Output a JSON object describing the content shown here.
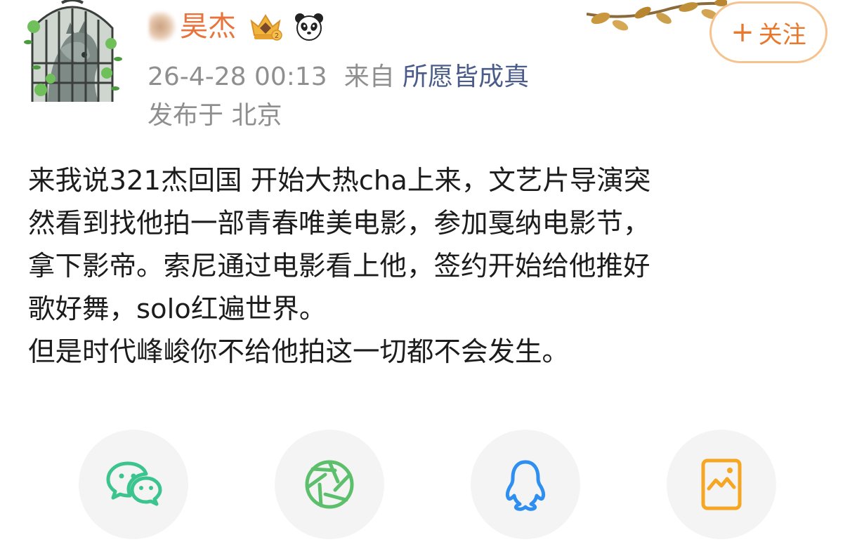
{
  "post": {
    "username": "昊杰",
    "datetime": "26-4-28 00:13",
    "source_prefix": "来自",
    "source_name": "所愿皆成真",
    "location": "发布于 北京",
    "follow_label": "关注",
    "text_lines": [
      "来我说321杰回国 开始大热cha上来，文艺片导演突",
      "然看到找他拍一部青春唯美电影，参加戛纳电影节，",
      "拿下影帝。索尼通过电影看上他，签约开始给他推好",
      "歌好舞，solo红遍世界。",
      "但是时代峰峻你不给他拍这一切都不会发生。"
    ]
  },
  "share": {
    "buttons": [
      {
        "icon": "wechat-icon"
      },
      {
        "icon": "moments-icon"
      },
      {
        "icon": "qq-icon"
      },
      {
        "icon": "image-share-icon"
      }
    ]
  },
  "colors": {
    "username": "#e8733b",
    "follow_border": "#f5c38f",
    "follow_text": "#e8782c",
    "meta_gray": "#8f8f8f",
    "source_link": "#4b5c8a",
    "wechat_green": "#3cc48e",
    "moments_green": "#5cbf6b",
    "qq_blue": "#2f8ff0",
    "image_orange": "#f5a623",
    "share_bg": "#f4f4f4"
  }
}
